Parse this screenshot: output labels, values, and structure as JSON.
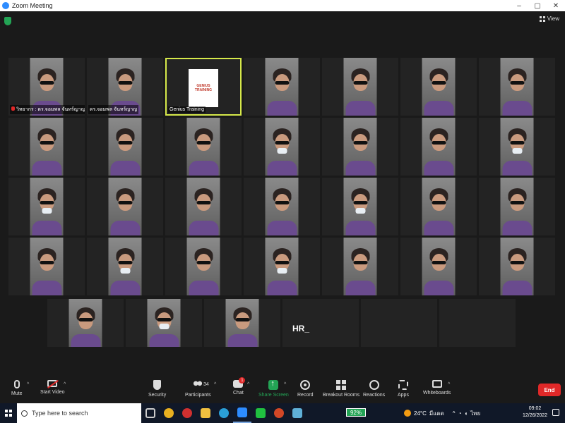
{
  "window": {
    "title": "Zoom Meeting",
    "controls": [
      "–",
      "▢",
      "✕"
    ]
  },
  "meeting": {
    "view_label": "View",
    "tiles": [
      {
        "row": 0,
        "col": 0,
        "name": "วิทยากร : ดร.จอมพล จันทร์ญาญ",
        "muted": true
      },
      {
        "row": 0,
        "col": 1,
        "name": "ดร.จอมพล จันทร์ญาญ",
        "muted": false
      },
      {
        "row": 0,
        "col": 2,
        "name": "Genius Training",
        "active": true,
        "logo": "GENIUS TRAINING"
      }
    ],
    "hr_name": "HR_"
  },
  "toolbar": {
    "mute": "Mute",
    "start_video": "Start Video",
    "security": "Security",
    "participants": "Participants",
    "participants_count": "34",
    "chat": "Chat",
    "chat_badge": "1",
    "share_screen": "Share Screen",
    "record": "Record",
    "breakout_rooms": "Breakout Rooms",
    "reactions": "Reactions",
    "apps": "Apps",
    "whiteboards": "Whiteboards",
    "end": "End"
  },
  "taskbar": {
    "search_placeholder": "Type here to search",
    "battery": "92%",
    "weather": "24°C",
    "weather_desc": "มีแดด",
    "lang": "ไทย",
    "time": "09:02",
    "date": "12/26/2022"
  },
  "colors": {
    "accent": "#2d8cff",
    "share_green": "#23a455",
    "end_red": "#e02828",
    "active_border": "#d6e94a"
  }
}
